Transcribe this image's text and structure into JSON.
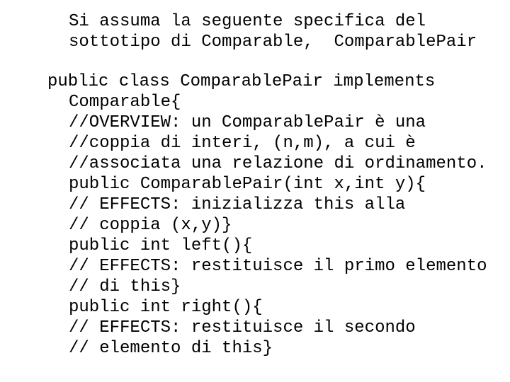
{
  "intro": {
    "lines": [
      "Si assuma la seguente specifica del",
      "sottotipo di Comparable,  ComparablePair"
    ]
  },
  "code": {
    "header": "public class ComparablePair implements",
    "lines": [
      "Comparable{",
      "//OVERVIEW: un ComparablePair è una",
      "//coppia di interi, (n,m), a cui è",
      "//associata una relazione di ordinamento.",
      "public ComparablePair(int x,int y){",
      "// EFFECTS: inizializza this alla",
      "// coppia (x,y)}",
      "public int left(){",
      "// EFFECTS: restituisce il primo elemento",
      "// di this}",
      "public int right(){",
      "// EFFECTS: restituisce il secondo",
      "// elemento di this}"
    ]
  }
}
